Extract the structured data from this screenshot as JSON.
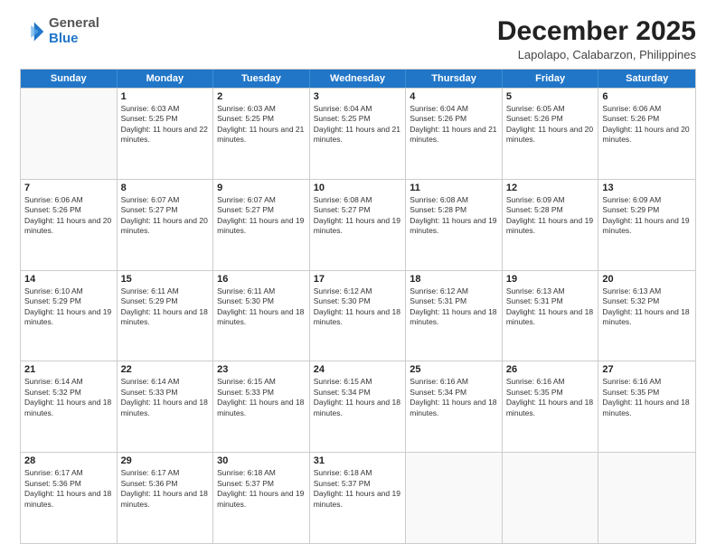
{
  "header": {
    "logo_general": "General",
    "logo_blue": "Blue",
    "month_title": "December 2025",
    "location": "Lapolapo, Calabarzon, Philippines"
  },
  "weekdays": [
    "Sunday",
    "Monday",
    "Tuesday",
    "Wednesday",
    "Thursday",
    "Friday",
    "Saturday"
  ],
  "rows": [
    [
      {
        "day": "",
        "sunrise": "",
        "sunset": "",
        "daylight": ""
      },
      {
        "day": "1",
        "sunrise": "Sunrise: 6:03 AM",
        "sunset": "Sunset: 5:25 PM",
        "daylight": "Daylight: 11 hours and 22 minutes."
      },
      {
        "day": "2",
        "sunrise": "Sunrise: 6:03 AM",
        "sunset": "Sunset: 5:25 PM",
        "daylight": "Daylight: 11 hours and 21 minutes."
      },
      {
        "day": "3",
        "sunrise": "Sunrise: 6:04 AM",
        "sunset": "Sunset: 5:25 PM",
        "daylight": "Daylight: 11 hours and 21 minutes."
      },
      {
        "day": "4",
        "sunrise": "Sunrise: 6:04 AM",
        "sunset": "Sunset: 5:26 PM",
        "daylight": "Daylight: 11 hours and 21 minutes."
      },
      {
        "day": "5",
        "sunrise": "Sunrise: 6:05 AM",
        "sunset": "Sunset: 5:26 PM",
        "daylight": "Daylight: 11 hours and 20 minutes."
      },
      {
        "day": "6",
        "sunrise": "Sunrise: 6:06 AM",
        "sunset": "Sunset: 5:26 PM",
        "daylight": "Daylight: 11 hours and 20 minutes."
      }
    ],
    [
      {
        "day": "7",
        "sunrise": "Sunrise: 6:06 AM",
        "sunset": "Sunset: 5:26 PM",
        "daylight": "Daylight: 11 hours and 20 minutes."
      },
      {
        "day": "8",
        "sunrise": "Sunrise: 6:07 AM",
        "sunset": "Sunset: 5:27 PM",
        "daylight": "Daylight: 11 hours and 20 minutes."
      },
      {
        "day": "9",
        "sunrise": "Sunrise: 6:07 AM",
        "sunset": "Sunset: 5:27 PM",
        "daylight": "Daylight: 11 hours and 19 minutes."
      },
      {
        "day": "10",
        "sunrise": "Sunrise: 6:08 AM",
        "sunset": "Sunset: 5:27 PM",
        "daylight": "Daylight: 11 hours and 19 minutes."
      },
      {
        "day": "11",
        "sunrise": "Sunrise: 6:08 AM",
        "sunset": "Sunset: 5:28 PM",
        "daylight": "Daylight: 11 hours and 19 minutes."
      },
      {
        "day": "12",
        "sunrise": "Sunrise: 6:09 AM",
        "sunset": "Sunset: 5:28 PM",
        "daylight": "Daylight: 11 hours and 19 minutes."
      },
      {
        "day": "13",
        "sunrise": "Sunrise: 6:09 AM",
        "sunset": "Sunset: 5:29 PM",
        "daylight": "Daylight: 11 hours and 19 minutes."
      }
    ],
    [
      {
        "day": "14",
        "sunrise": "Sunrise: 6:10 AM",
        "sunset": "Sunset: 5:29 PM",
        "daylight": "Daylight: 11 hours and 19 minutes."
      },
      {
        "day": "15",
        "sunrise": "Sunrise: 6:11 AM",
        "sunset": "Sunset: 5:29 PM",
        "daylight": "Daylight: 11 hours and 18 minutes."
      },
      {
        "day": "16",
        "sunrise": "Sunrise: 6:11 AM",
        "sunset": "Sunset: 5:30 PM",
        "daylight": "Daylight: 11 hours and 18 minutes."
      },
      {
        "day": "17",
        "sunrise": "Sunrise: 6:12 AM",
        "sunset": "Sunset: 5:30 PM",
        "daylight": "Daylight: 11 hours and 18 minutes."
      },
      {
        "day": "18",
        "sunrise": "Sunrise: 6:12 AM",
        "sunset": "Sunset: 5:31 PM",
        "daylight": "Daylight: 11 hours and 18 minutes."
      },
      {
        "day": "19",
        "sunrise": "Sunrise: 6:13 AM",
        "sunset": "Sunset: 5:31 PM",
        "daylight": "Daylight: 11 hours and 18 minutes."
      },
      {
        "day": "20",
        "sunrise": "Sunrise: 6:13 AM",
        "sunset": "Sunset: 5:32 PM",
        "daylight": "Daylight: 11 hours and 18 minutes."
      }
    ],
    [
      {
        "day": "21",
        "sunrise": "Sunrise: 6:14 AM",
        "sunset": "Sunset: 5:32 PM",
        "daylight": "Daylight: 11 hours and 18 minutes."
      },
      {
        "day": "22",
        "sunrise": "Sunrise: 6:14 AM",
        "sunset": "Sunset: 5:33 PM",
        "daylight": "Daylight: 11 hours and 18 minutes."
      },
      {
        "day": "23",
        "sunrise": "Sunrise: 6:15 AM",
        "sunset": "Sunset: 5:33 PM",
        "daylight": "Daylight: 11 hours and 18 minutes."
      },
      {
        "day": "24",
        "sunrise": "Sunrise: 6:15 AM",
        "sunset": "Sunset: 5:34 PM",
        "daylight": "Daylight: 11 hours and 18 minutes."
      },
      {
        "day": "25",
        "sunrise": "Sunrise: 6:16 AM",
        "sunset": "Sunset: 5:34 PM",
        "daylight": "Daylight: 11 hours and 18 minutes."
      },
      {
        "day": "26",
        "sunrise": "Sunrise: 6:16 AM",
        "sunset": "Sunset: 5:35 PM",
        "daylight": "Daylight: 11 hours and 18 minutes."
      },
      {
        "day": "27",
        "sunrise": "Sunrise: 6:16 AM",
        "sunset": "Sunset: 5:35 PM",
        "daylight": "Daylight: 11 hours and 18 minutes."
      }
    ],
    [
      {
        "day": "28",
        "sunrise": "Sunrise: 6:17 AM",
        "sunset": "Sunset: 5:36 PM",
        "daylight": "Daylight: 11 hours and 18 minutes."
      },
      {
        "day": "29",
        "sunrise": "Sunrise: 6:17 AM",
        "sunset": "Sunset: 5:36 PM",
        "daylight": "Daylight: 11 hours and 18 minutes."
      },
      {
        "day": "30",
        "sunrise": "Sunrise: 6:18 AM",
        "sunset": "Sunset: 5:37 PM",
        "daylight": "Daylight: 11 hours and 19 minutes."
      },
      {
        "day": "31",
        "sunrise": "Sunrise: 6:18 AM",
        "sunset": "Sunset: 5:37 PM",
        "daylight": "Daylight: 11 hours and 19 minutes."
      },
      {
        "day": "",
        "sunrise": "",
        "sunset": "",
        "daylight": ""
      },
      {
        "day": "",
        "sunrise": "",
        "sunset": "",
        "daylight": ""
      },
      {
        "day": "",
        "sunrise": "",
        "sunset": "",
        "daylight": ""
      }
    ]
  ]
}
